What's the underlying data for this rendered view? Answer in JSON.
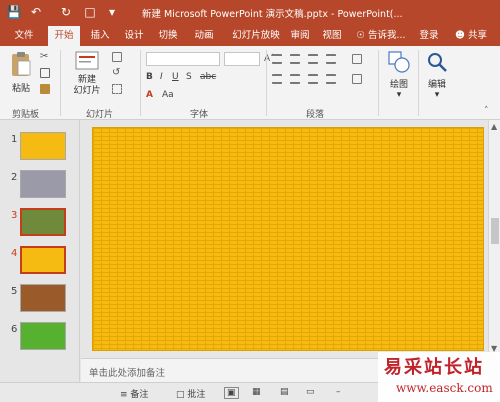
{
  "titlebar": {
    "title": "新建 Microsoft PowerPoint 演示文稿.pptx - PowerPoint(..."
  },
  "ribbon_tabs": [
    "文件",
    "开始",
    "插入",
    "设计",
    "切换",
    "动画",
    "幻灯片放映",
    "审阅",
    "视图"
  ],
  "tell_me": "告诉我...",
  "signin": "登录",
  "share": "共享",
  "ribbon": {
    "paste": "粘贴",
    "new_slide": "新建\n幻灯片",
    "drawing": "绘图",
    "editing": "编辑",
    "groups": [
      "剪贴板",
      "幻灯片",
      "字体",
      "段落"
    ]
  },
  "slide_numbers": [
    "1",
    "2",
    "3",
    "4",
    "5",
    "6"
  ],
  "notes_placeholder": "单击此处添加备注",
  "statusbar": {
    "notes": "备注",
    "comments": "批注"
  },
  "watermark": {
    "cn": "易采站长站",
    "en": "www.easck.com"
  },
  "colors": {
    "accent": "#b7472a",
    "selection": "#c43e1c",
    "slide_fill": "#f5bb12"
  }
}
